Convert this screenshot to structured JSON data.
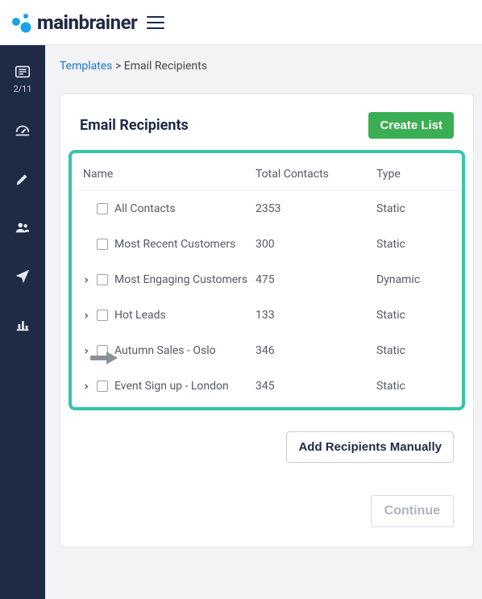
{
  "brand": {
    "name_bold": "main",
    "name_rest": "brainer"
  },
  "sidebar": {
    "step_counter": "2/11"
  },
  "breadcrumb": {
    "link": "Templates",
    "sep": ">",
    "current": "Email Recipients"
  },
  "card": {
    "title": "Email Recipients",
    "create_label": "Create List"
  },
  "table": {
    "head": {
      "name": "Name",
      "total": "Total Contacts",
      "type": "Type"
    },
    "rows": [
      {
        "has_chevron": false,
        "name": "All Contacts",
        "total": "2353",
        "type": "Static"
      },
      {
        "has_chevron": false,
        "name": "Most Recent Customers",
        "total": "300",
        "type": "Static"
      },
      {
        "has_chevron": true,
        "name": "Most Engaging Customers",
        "total": "475",
        "type": "Dynamic"
      },
      {
        "has_chevron": true,
        "name": "Hot Leads",
        "total": "133",
        "type": "Static"
      },
      {
        "has_chevron": true,
        "name": "Autumn Sales - Oslo",
        "total": "346",
        "type": "Static"
      },
      {
        "has_chevron": true,
        "name": "Event Sign up - London",
        "total": "345",
        "type": "Static"
      }
    ]
  },
  "actions": {
    "add_manual": "Add Recipients Manually",
    "continue": "Continue"
  }
}
